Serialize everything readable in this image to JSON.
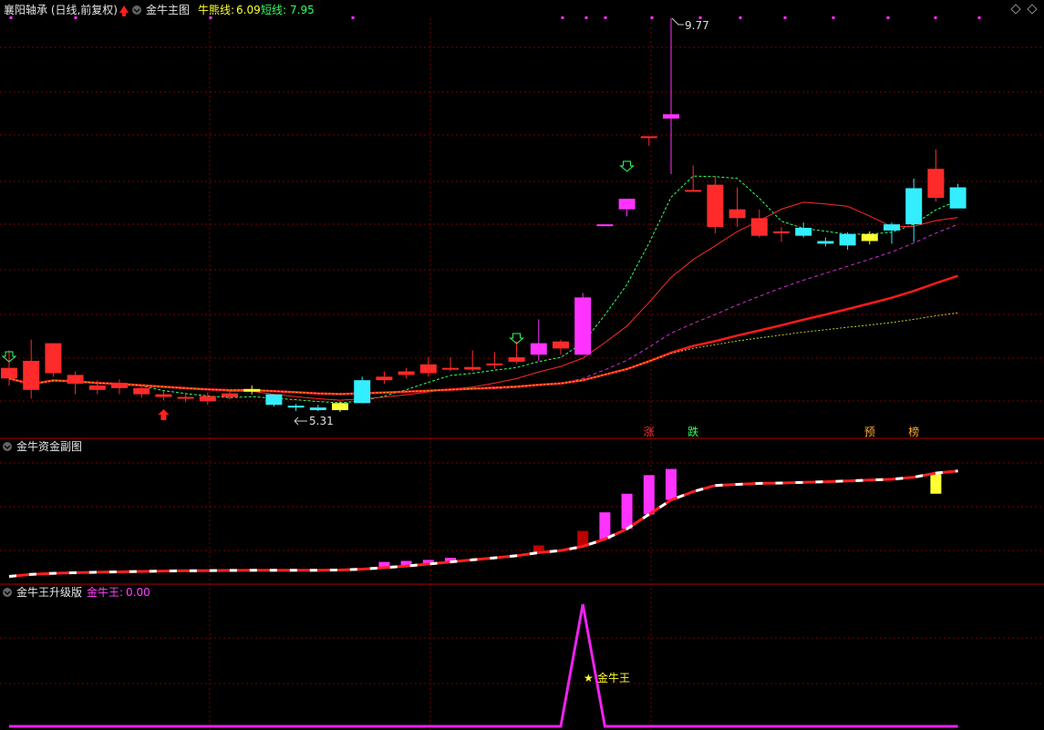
{
  "header": {
    "stock_label": "襄阳轴承 (日线,前复权)",
    "indicator_main": "金牛主图",
    "line1_label": "牛熊线:",
    "line1_value": "6.09",
    "line2_label": "短线:",
    "line2_value": "7.95"
  },
  "subpanel1": {
    "title": "金牛资金副图"
  },
  "subpanel2": {
    "title": "金牛王升级版",
    "value_label": "金牛王:",
    "value": "0.00",
    "annotation": "金牛王"
  },
  "colors": {
    "up": "#ff2a2a",
    "down": "#33eeff",
    "special_up": "#ff33ff",
    "special_flat": "#ffff33",
    "grid": "#7a0000",
    "label_red": "#ff3030",
    "label_green": "#33ff66",
    "label_yellow": "#ffff33",
    "magenta": "#ee22ee"
  },
  "chart_data": {
    "type": "candlestick",
    "price_annotations": {
      "high": "9.77",
      "low": "5.31"
    },
    "event_tags": [
      {
        "index": 29,
        "text": "涨"
      },
      {
        "index": 31,
        "text": "跌"
      },
      {
        "index": 39,
        "text": "预"
      },
      {
        "index": 41,
        "text": "榜"
      }
    ],
    "candles": [
      {
        "o": 5.8,
        "h": 6.0,
        "l": 5.6,
        "c": 5.68,
        "color": "up"
      },
      {
        "o": 5.88,
        "h": 6.12,
        "l": 5.45,
        "c": 5.55,
        "color": "up"
      },
      {
        "o": 6.08,
        "h": 6.08,
        "l": 5.7,
        "c": 5.74,
        "color": "up"
      },
      {
        "o": 5.72,
        "h": 5.76,
        "l": 5.5,
        "c": 5.62,
        "color": "up"
      },
      {
        "o": 5.6,
        "h": 5.66,
        "l": 5.5,
        "c": 5.55,
        "color": "up"
      },
      {
        "o": 5.63,
        "h": 5.67,
        "l": 5.5,
        "c": 5.57,
        "color": "up"
      },
      {
        "o": 5.57,
        "h": 5.6,
        "l": 5.46,
        "c": 5.5,
        "color": "up"
      },
      {
        "o": 5.5,
        "h": 5.54,
        "l": 5.43,
        "c": 5.47,
        "color": "up"
      },
      {
        "o": 5.47,
        "h": 5.52,
        "l": 5.41,
        "c": 5.45,
        "color": "up"
      },
      {
        "o": 5.48,
        "h": 5.52,
        "l": 5.38,
        "c": 5.42,
        "color": "up"
      },
      {
        "o": 5.51,
        "h": 5.55,
        "l": 5.44,
        "c": 5.47,
        "color": "up"
      },
      {
        "o": 5.53,
        "h": 5.6,
        "l": 5.5,
        "c": 5.56,
        "color": "flat"
      },
      {
        "o": 5.5,
        "h": 5.5,
        "l": 5.36,
        "c": 5.38,
        "color": "down"
      },
      {
        "o": 5.37,
        "h": 5.39,
        "l": 5.31,
        "c": 5.36,
        "color": "down"
      },
      {
        "o": 5.35,
        "h": 5.38,
        "l": 5.31,
        "c": 5.32,
        "color": "down"
      },
      {
        "o": 5.32,
        "h": 5.42,
        "l": 5.3,
        "c": 5.4,
        "color": "flat"
      },
      {
        "o": 5.4,
        "h": 5.7,
        "l": 5.4,
        "c": 5.66,
        "color": "down"
      },
      {
        "o": 5.7,
        "h": 5.76,
        "l": 5.62,
        "c": 5.66,
        "color": "up"
      },
      {
        "o": 5.76,
        "h": 5.8,
        "l": 5.68,
        "c": 5.72,
        "color": "up"
      },
      {
        "o": 5.84,
        "h": 5.92,
        "l": 5.7,
        "c": 5.74,
        "color": "up"
      },
      {
        "o": 5.8,
        "h": 5.92,
        "l": 5.76,
        "c": 5.79,
        "color": "up"
      },
      {
        "o": 5.81,
        "h": 6.0,
        "l": 5.76,
        "c": 5.78,
        "color": "up"
      },
      {
        "o": 5.85,
        "h": 5.98,
        "l": 5.79,
        "c": 5.84,
        "color": "up"
      },
      {
        "o": 5.92,
        "h": 6.1,
        "l": 5.85,
        "c": 5.87,
        "color": "up"
      },
      {
        "o": 5.95,
        "h": 6.35,
        "l": 5.88,
        "c": 6.08,
        "color": "special_up"
      },
      {
        "o": 6.1,
        "h": 6.12,
        "l": 5.95,
        "c": 6.02,
        "color": "up"
      },
      {
        "o": 5.95,
        "h": 6.65,
        "l": 5.95,
        "c": 6.6,
        "color": "special_up"
      },
      {
        "o": 7.43,
        "h": 7.43,
        "l": 7.43,
        "c": 7.43,
        "color": "special_up"
      },
      {
        "o": 7.72,
        "h": 7.72,
        "l": 7.52,
        "c": 7.6,
        "color": "special_up"
      },
      {
        "o": 8.43,
        "h": 8.43,
        "l": 8.32,
        "c": 8.43,
        "color": "up"
      },
      {
        "o": 8.68,
        "h": 9.77,
        "l": 8.0,
        "c": 8.63,
        "color": "special_up"
      },
      {
        "o": 7.82,
        "h": 8.1,
        "l": 7.8,
        "c": 7.8,
        "color": "up"
      },
      {
        "o": 7.88,
        "h": 7.98,
        "l": 7.33,
        "c": 7.4,
        "color": "up"
      },
      {
        "o": 7.6,
        "h": 7.85,
        "l": 7.4,
        "c": 7.5,
        "color": "up"
      },
      {
        "o": 7.5,
        "h": 7.6,
        "l": 7.28,
        "c": 7.3,
        "color": "up"
      },
      {
        "o": 7.35,
        "h": 7.4,
        "l": 7.23,
        "c": 7.33,
        "color": "up"
      },
      {
        "o": 7.3,
        "h": 7.45,
        "l": 7.28,
        "c": 7.39,
        "color": "down"
      },
      {
        "o": 7.21,
        "h": 7.28,
        "l": 7.18,
        "c": 7.24,
        "color": "down"
      },
      {
        "o": 7.19,
        "h": 7.34,
        "l": 7.14,
        "c": 7.32,
        "color": "down"
      },
      {
        "o": 7.24,
        "h": 7.35,
        "l": 7.2,
        "c": 7.32,
        "color": "flat"
      },
      {
        "o": 7.36,
        "h": 7.45,
        "l": 7.21,
        "c": 7.43,
        "color": "down"
      },
      {
        "o": 7.43,
        "h": 7.95,
        "l": 7.23,
        "c": 7.84,
        "color": "down"
      },
      {
        "o": 7.73,
        "h": 8.28,
        "l": 7.69,
        "c": 8.06,
        "color": "up"
      },
      {
        "o": 7.61,
        "h": 7.89,
        "l": 7.61,
        "c": 7.85,
        "color": "down"
      }
    ],
    "sub1_series": [
      0.2,
      0.3,
      0.35,
      0.38,
      0.4,
      0.42,
      0.44,
      0.46,
      0.47,
      0.48,
      0.49,
      0.5,
      0.5,
      0.5,
      0.5,
      0.51,
      0.55,
      0.62,
      0.7,
      0.8,
      0.9,
      1.0,
      1.1,
      1.2,
      1.35,
      1.45,
      1.65,
      2.0,
      2.5,
      3.2,
      3.9,
      4.3,
      4.6,
      4.65,
      4.7,
      4.72,
      4.75,
      4.78,
      4.82,
      4.86,
      4.9,
      5.0,
      5.2,
      5.3
    ],
    "sub1_bars": [
      {
        "index": 16,
        "top": 0.55,
        "color": "yellow"
      },
      {
        "index": 17,
        "top": 0.9,
        "color": "magenta"
      },
      {
        "index": 18,
        "top": 0.95,
        "color": "magenta"
      },
      {
        "index": 19,
        "top": 1.0,
        "color": "magenta"
      },
      {
        "index": 20,
        "top": 1.1,
        "color": "magenta"
      },
      {
        "index": 24,
        "top": 1.7,
        "color": "darkred"
      },
      {
        "index": 26,
        "top": 2.4,
        "color": "darkred"
      },
      {
        "index": 27,
        "top": 3.3,
        "color": "magenta"
      },
      {
        "index": 28,
        "top": 4.2,
        "color": "magenta"
      },
      {
        "index": 29,
        "top": 5.1,
        "color": "magenta"
      },
      {
        "index": 30,
        "top": 5.4,
        "color": "magenta"
      },
      {
        "index": 42,
        "top": 4.2,
        "color": "yellow"
      }
    ],
    "sub2_series": [
      0,
      0,
      0,
      0,
      0,
      0,
      0,
      0,
      0,
      0,
      0,
      0,
      0,
      0,
      0,
      0,
      0,
      0,
      0,
      0,
      0,
      0,
      0,
      0,
      0,
      0,
      1,
      0,
      0,
      0,
      0,
      0,
      0,
      0,
      0,
      0,
      0,
      0,
      0,
      0,
      0,
      0,
      0,
      0
    ]
  }
}
